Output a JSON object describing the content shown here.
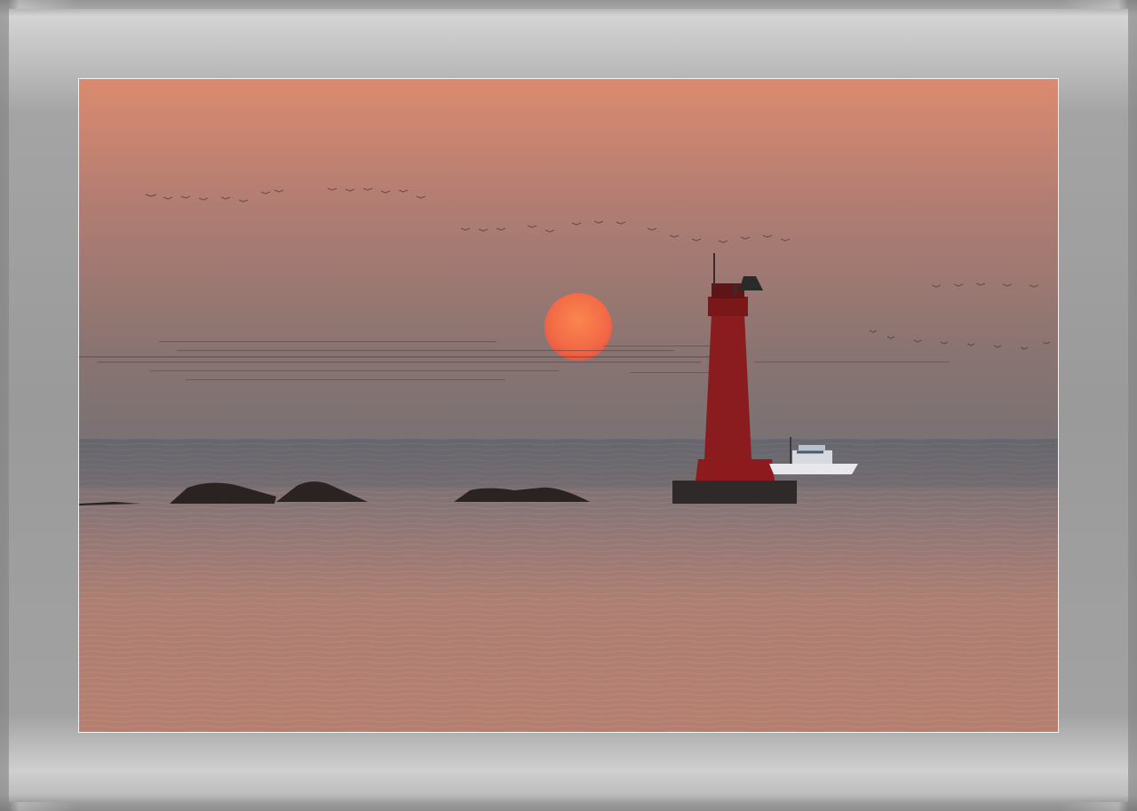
{
  "photo": {
    "subject": "sunset-over-sea-with-lighthouse",
    "colors": {
      "sky_top": "#d98b72",
      "sky_mid": "#a77c72",
      "sky_horizon": "#7c7172",
      "sun": "#f26a48",
      "sea_top": "#6b6a70",
      "sea_bottom": "#b8806c",
      "lighthouse": "#8a1a1c",
      "rocks": "#2a2322",
      "frame": "#9a9a9a"
    },
    "elements": [
      "sun",
      "lighthouse",
      "fishing-boat",
      "rocks",
      "bird-flock",
      "sea"
    ]
  }
}
